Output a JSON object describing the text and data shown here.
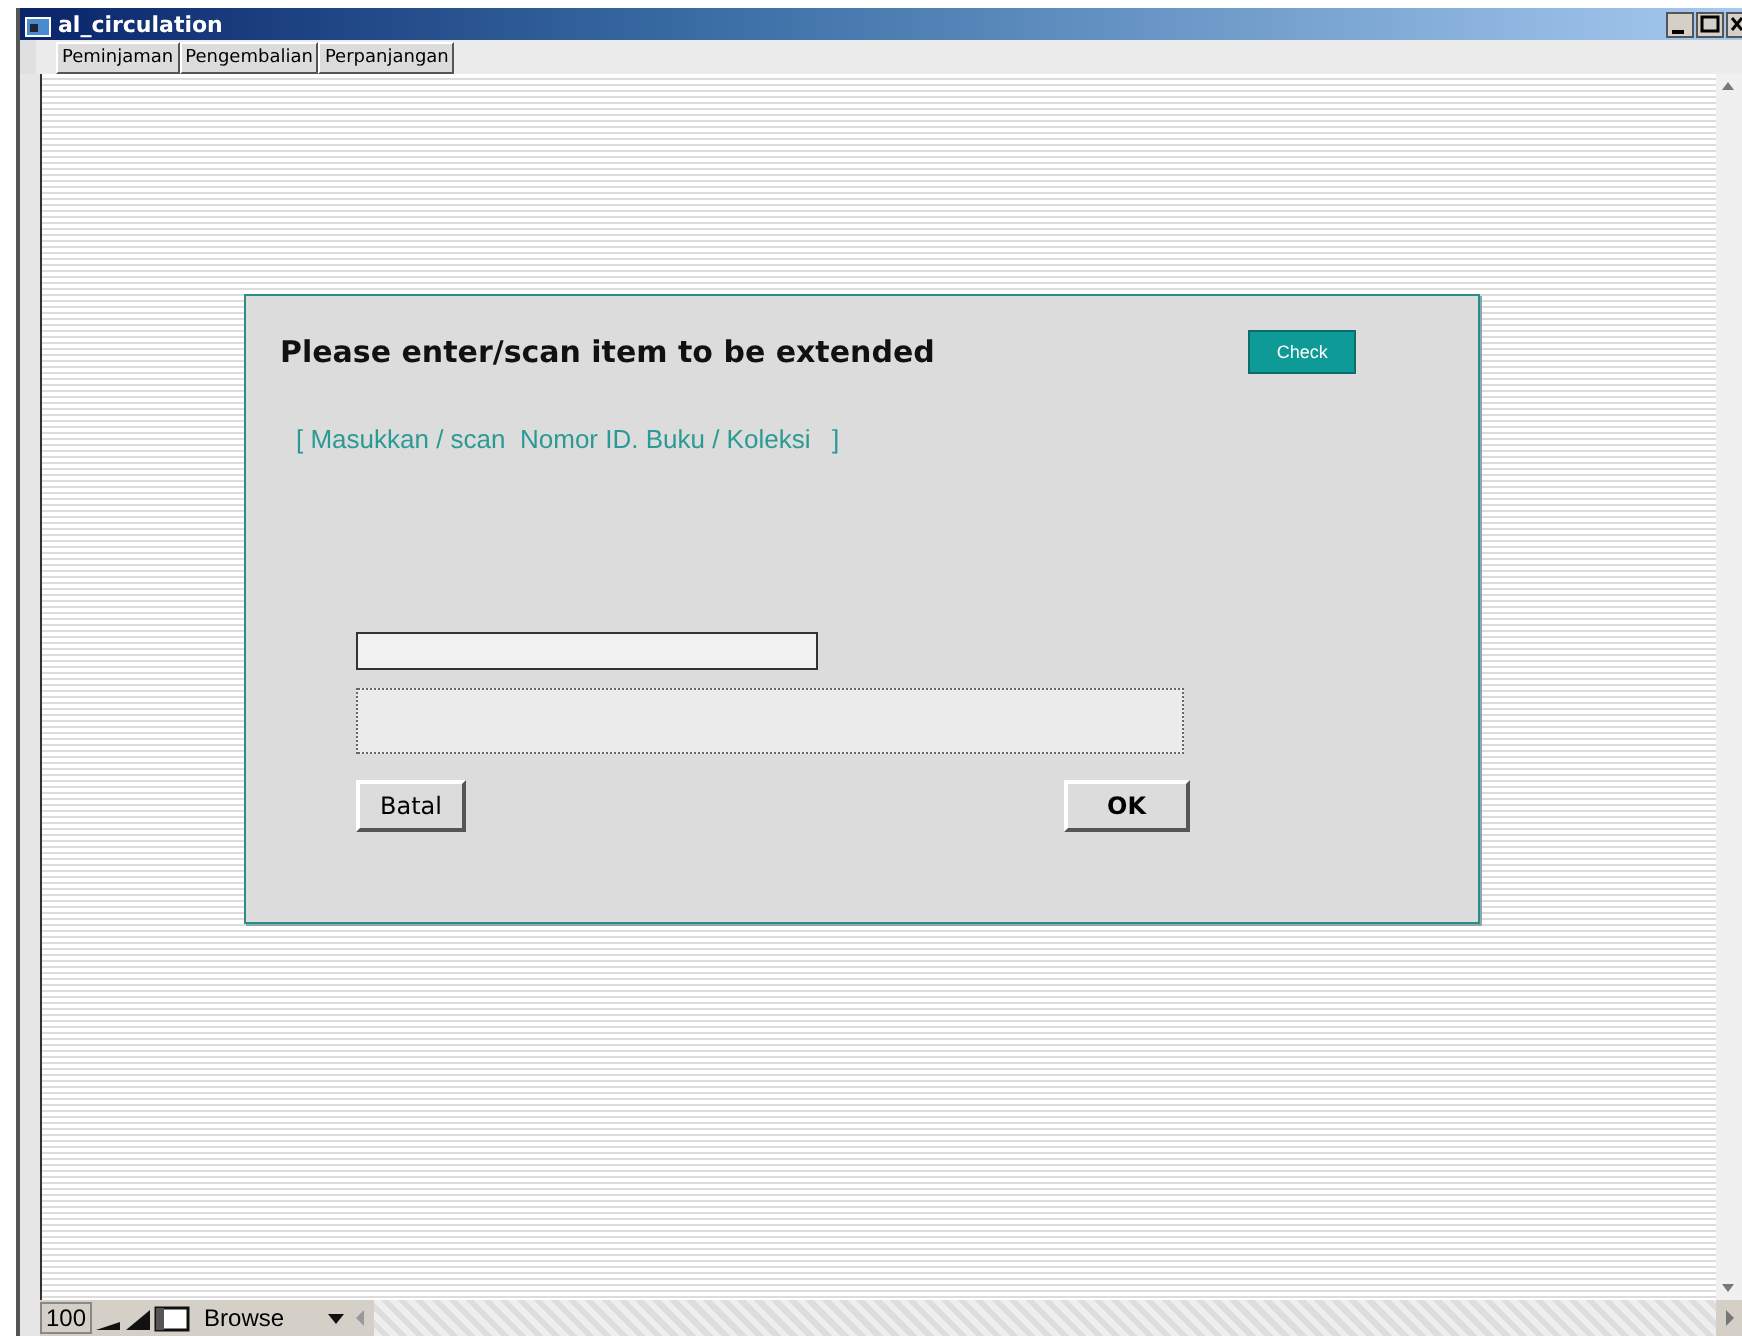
{
  "window": {
    "title": "al_circulation"
  },
  "tabs": [
    {
      "label": "Peminjaman"
    },
    {
      "label": "Pengembalian"
    },
    {
      "label": "Perpanjangan"
    }
  ],
  "dialog": {
    "heading": "Please enter/scan item to be extended",
    "check_button": "Check",
    "hint": "[ Masukkan / scan  Nomor ID. Buku / Koleksi   ]",
    "cancel_button": "Batal",
    "ok_button": "OK"
  },
  "status_bar": {
    "zoom": "100",
    "mode": "Browse"
  }
}
